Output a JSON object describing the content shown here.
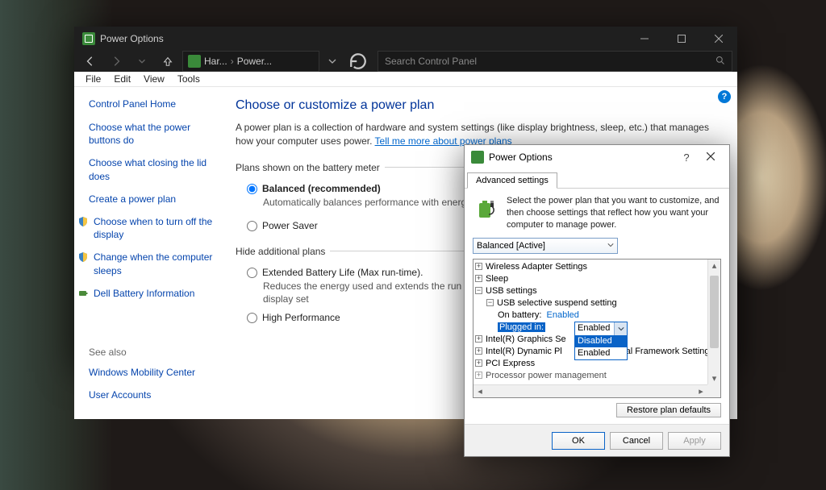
{
  "window": {
    "title": "Power Options",
    "breadcrumb": {
      "item1": "Har...",
      "item2": "Power..."
    },
    "search_placeholder": "Search Control Panel",
    "menus": [
      "File",
      "Edit",
      "View",
      "Tools"
    ]
  },
  "sidebar": {
    "home": "Control Panel Home",
    "links": [
      "Choose what the power buttons do",
      "Choose what closing the lid does",
      "Create a power plan",
      "Choose when to turn off the display",
      "Change when the computer sleeps",
      "Dell Battery Information"
    ],
    "see_also_label": "See also",
    "see_also": [
      "Windows Mobility Center",
      "User Accounts"
    ]
  },
  "main": {
    "heading": "Choose or customize a power plan",
    "desc_pre": "A power plan is a collection of hardware and system settings (like display brightness, sleep, etc.) that manages how your computer uses power. ",
    "desc_link": "Tell me more about power plans",
    "group1_legend": "Plans shown on the battery meter",
    "plan1": {
      "name": "Balanced (recommended)",
      "desc": "Automatically balances performance with energy consum"
    },
    "plan2": {
      "name": "Power Saver"
    },
    "group2_legend": "Hide additional plans",
    "plan3": {
      "name": "Extended Battery Life (Max run-time).",
      "desc": "Reduces the energy used and extends the run time of you non-essential ports and devices and adjusting display set"
    },
    "plan4": {
      "name": "High Performance"
    }
  },
  "dialog": {
    "title": "Power Options",
    "tab": "Advanced settings",
    "intro": "Select the power plan that you want to customize, and then choose settings that reflect how you want your computer to manage power.",
    "plan_select": "Balanced [Active]",
    "tree": {
      "n1": "Wireless Adapter Settings",
      "n2": "Sleep",
      "n3": "USB settings",
      "n3a": "USB selective suspend setting",
      "n3a1_label": "On battery:",
      "n3a1_val": "Enabled",
      "n3a2_label": "Plugged in:",
      "n3a2_val": "Enabled",
      "n4": "Intel(R) Graphics Se",
      "n5": "Intel(R) Dynamic Pl",
      "n5_tail": "rmal Framework Setting",
      "n6": "PCI Express",
      "n7": "Processor power management"
    },
    "dropdown": {
      "opt1": "Disabled",
      "opt2": "Enabled"
    },
    "restore_btn": "Restore plan defaults",
    "ok": "OK",
    "cancel": "Cancel",
    "apply": "Apply"
  }
}
